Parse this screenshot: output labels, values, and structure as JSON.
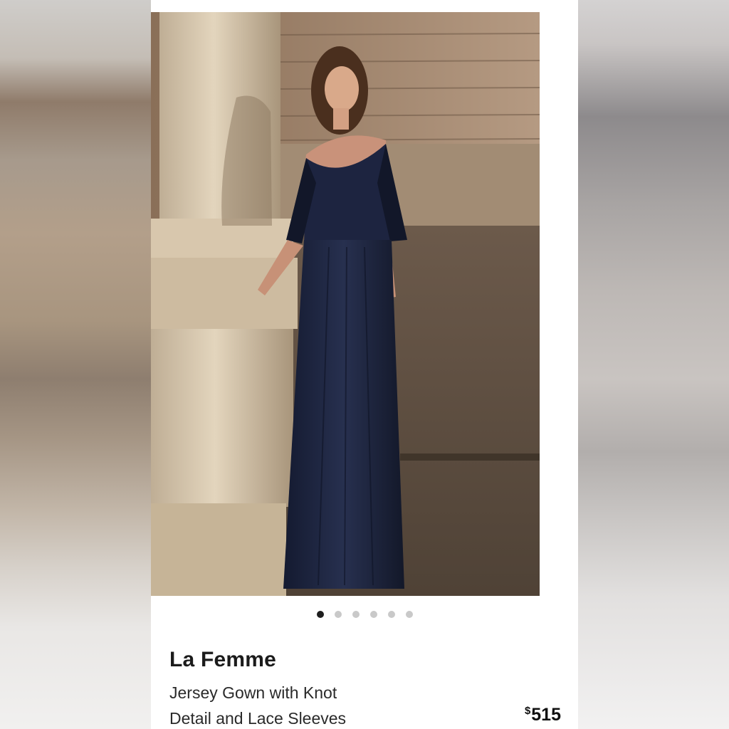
{
  "listing": {
    "brand": "La Femme",
    "product_name_line1": "Jersey Gown with Knot",
    "product_name_line2": "Detail and Lace Sleeves",
    "price_currency": "$",
    "price_value": "515"
  },
  "carousel": {
    "total_images": 6,
    "active_index": 0
  },
  "icons": {
    "carousel_dot": "dot-indicator"
  },
  "colors": {
    "card_background": "#ffffff",
    "dot_active": "#1e1e1e",
    "dot_inactive": "#c9c9c9",
    "text_primary": "#1b1b1b",
    "gown_color": "#1f2540"
  }
}
